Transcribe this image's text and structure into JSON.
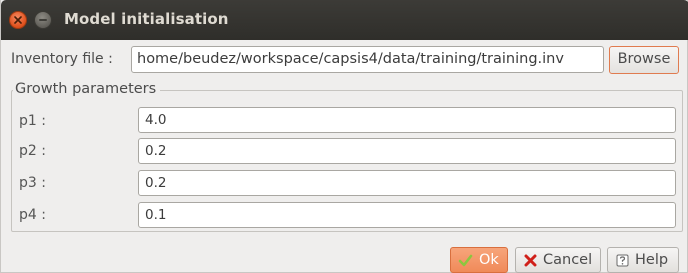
{
  "window": {
    "title": "Model initialisation"
  },
  "inventory": {
    "label": "Inventory file :",
    "value": "home/beudez/workspace/capsis4/data/training/training.inv",
    "browse_label": "Browse"
  },
  "growth": {
    "title": "Growth parameters",
    "params": [
      {
        "label": "p1 :",
        "value": "4.0"
      },
      {
        "label": "p2 :",
        "value": "0.2"
      },
      {
        "label": "p3 :",
        "value": "0.2"
      },
      {
        "label": "p4 :",
        "value": "0.1"
      }
    ]
  },
  "buttons": {
    "ok_label": "Ok",
    "cancel_label": "Cancel",
    "help_label": "Help"
  },
  "icons": {
    "close": "close-icon",
    "minimize": "minimize-icon",
    "ok": "checkmark-icon",
    "cancel": "cross-icon",
    "help": "help-book-icon"
  },
  "colors": {
    "titlebar": "#3c3b37",
    "accent": "#f08a59",
    "cancel_red": "#d0201a",
    "ok_check": "#8cc63f"
  }
}
